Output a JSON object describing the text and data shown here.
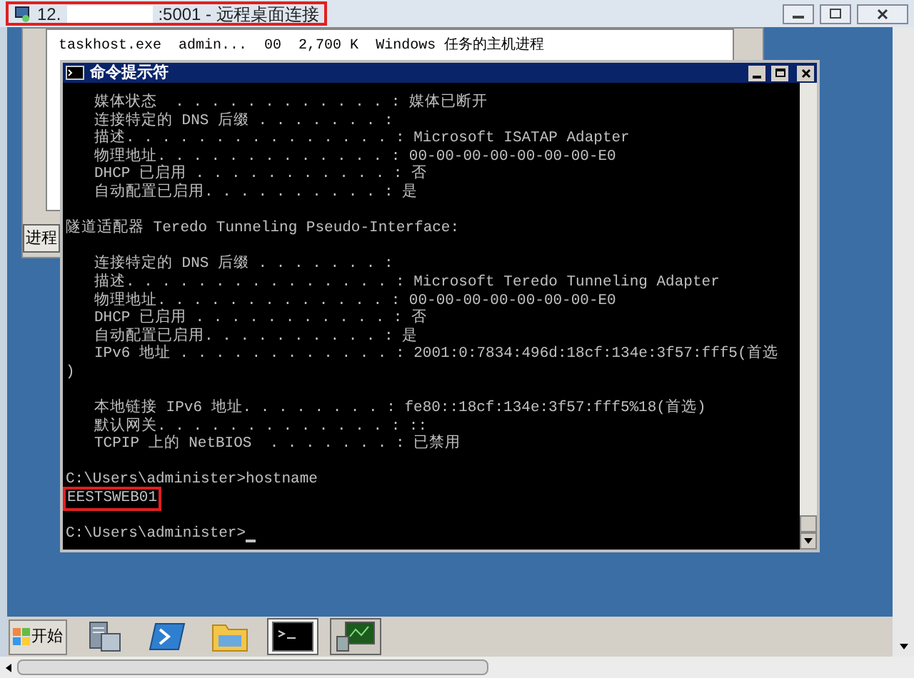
{
  "window": {
    "title_parts": [
      "12.",
      ":5001 - 远程桌面连接"
    ],
    "highlighted": true
  },
  "task_manager": {
    "rows": [
      {
        "cells": [
          "taskhost.exe",
          "admin...",
          "00",
          "2,700 K",
          "Windows 任务的主机进程"
        ]
      }
    ],
    "tab_button": "进程"
  },
  "console": {
    "title": "命令提示符",
    "lines": [
      {
        "kind": "entry",
        "text": "媒体状态  . . . . . . . . . . . . : 媒体已断开"
      },
      {
        "kind": "entry",
        "text": "连接特定的 DNS 后缀 . . . . . . . :"
      },
      {
        "kind": "entry",
        "text": "描述. . . . . . . . . . . . . . . : Microsoft ISATAP Adapter"
      },
      {
        "kind": "entry",
        "text": "物理地址. . . . . . . . . . . . . : 00-00-00-00-00-00-00-E0"
      },
      {
        "kind": "entry",
        "text": "DHCP 已启用 . . . . . . . . . . . : 否"
      },
      {
        "kind": "entry",
        "text": "自动配置已启用. . . . . . . . . . : 是"
      },
      {
        "kind": "blank"
      },
      {
        "kind": "text",
        "text": "隧道适配器 Teredo Tunneling Pseudo-Interface:"
      },
      {
        "kind": "blank"
      },
      {
        "kind": "entry",
        "text": "连接特定的 DNS 后缀 . . . . . . . :"
      },
      {
        "kind": "entry",
        "text": "描述. . . . . . . . . . . . . . . : Microsoft Teredo Tunneling Adapter"
      },
      {
        "kind": "entry",
        "text": "物理地址. . . . . . . . . . . . . : 00-00-00-00-00-00-00-E0"
      },
      {
        "kind": "entry",
        "text": "DHCP 已启用 . . . . . . . . . . . : 否"
      },
      {
        "kind": "entry",
        "text": "自动配置已启用. . . . . . . . . . : 是"
      },
      {
        "kind": "entry",
        "text": "IPv6 地址 . . . . . . . . . . . . : 2001:0:7834:496d:18cf:134e:3f57:fff5(首选"
      },
      {
        "kind": "text",
        "text": ")"
      },
      {
        "kind": "blank"
      },
      {
        "kind": "entry",
        "text": "本地链接 IPv6 地址. . . . . . . . : fe80::18cf:134e:3f57:fff5%18(首选)"
      },
      {
        "kind": "entry",
        "text": "默认网关. . . . . . . . . . . . . : ::"
      },
      {
        "kind": "entry",
        "text": "TCPIP 上的 NetBIOS  . . . . . . . : 已禁用"
      },
      {
        "kind": "blank"
      },
      {
        "kind": "text",
        "text": "C:\\Users\\administer>hostname"
      },
      {
        "kind": "text",
        "highlighted": true,
        "text": "EESTSWEB01"
      },
      {
        "kind": "blank"
      },
      {
        "kind": "prompt",
        "text": "C:\\Users\\administer>"
      }
    ]
  },
  "taskbar": {
    "start_label": "开始",
    "items": [
      {
        "kind": "server",
        "open": false,
        "selected": false
      },
      {
        "kind": "powershell",
        "open": false,
        "selected": false
      },
      {
        "kind": "folder",
        "open": false,
        "selected": false
      },
      {
        "kind": "console",
        "open": true,
        "selected": true
      },
      {
        "kind": "monitor",
        "open": true,
        "selected": false
      }
    ]
  }
}
